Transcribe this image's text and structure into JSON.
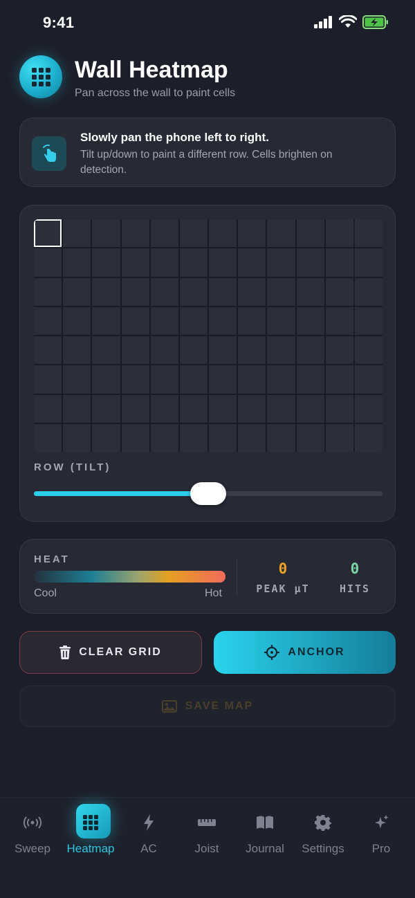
{
  "status": {
    "time": "9:41"
  },
  "header": {
    "title": "Wall Heatmap",
    "subtitle": "Pan across the wall to paint cells"
  },
  "hint": {
    "title": "Slowly pan the phone left to right.",
    "body": "Tilt up/down to paint a different row. Cells brighten on detection."
  },
  "grid": {
    "columns": 12,
    "rows": 8,
    "active_cell": [
      0,
      0
    ]
  },
  "row_slider": {
    "label": "ROW (TILT)",
    "value_fraction": 0.5
  },
  "heat": {
    "label": "HEAT",
    "cool_label": "Cool",
    "hot_label": "Hot",
    "peak_value": "0",
    "peak_label": "PEAK µT",
    "hits_value": "0",
    "hits_label": "HITS"
  },
  "actions": {
    "clear": "CLEAR GRID",
    "anchor": "ANCHOR",
    "save": "SAVE MAP"
  },
  "colors": {
    "accent": "#2ccfe8",
    "peak": "#f0a423",
    "hits": "#7dd6a6"
  },
  "tabs": [
    {
      "label": "Sweep",
      "icon": "broadcast-icon"
    },
    {
      "label": "Heatmap",
      "icon": "grid-icon",
      "active": true
    },
    {
      "label": "AC",
      "icon": "lightning-icon"
    },
    {
      "label": "Joist",
      "icon": "ruler-icon"
    },
    {
      "label": "Journal",
      "icon": "book-icon"
    },
    {
      "label": "Settings",
      "icon": "gear-icon"
    },
    {
      "label": "Pro",
      "icon": "sparkle-icon"
    }
  ]
}
